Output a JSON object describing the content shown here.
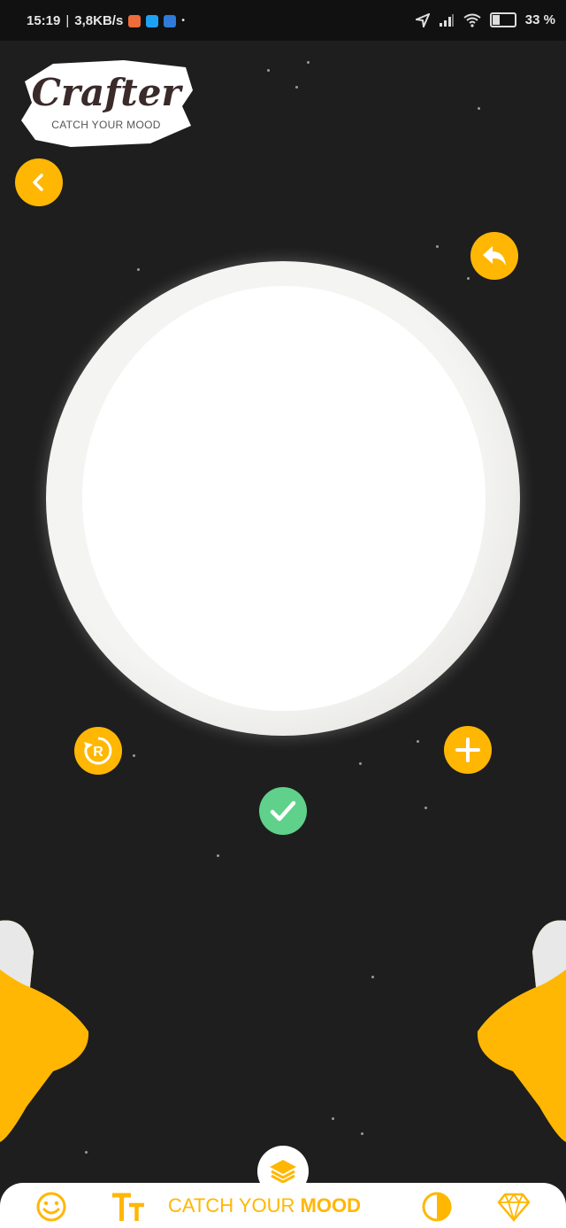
{
  "status_bar": {
    "time": "15:19",
    "speed": "3,8KB/s",
    "battery": "33 %",
    "separator": "|",
    "dot": "•",
    "app_icon_colors": [
      "#ee6b3a",
      "#1da1f2",
      "#2f7bd9"
    ],
    "battery_level": 0.33
  },
  "logo": {
    "title": "Crafter",
    "subtitle": "CATCH YOUR MOOD"
  },
  "bottom_bar": {
    "brand_regular": "CATCH YOUR ",
    "brand_bold": "MOOD",
    "items": [
      "emoji-icon",
      "text-style-icon",
      "contrast-icon",
      "diamond-icon"
    ]
  },
  "colors": {
    "accent": "#ffb703",
    "background": "#1e1e1e",
    "confirm": "#5fd18a"
  }
}
